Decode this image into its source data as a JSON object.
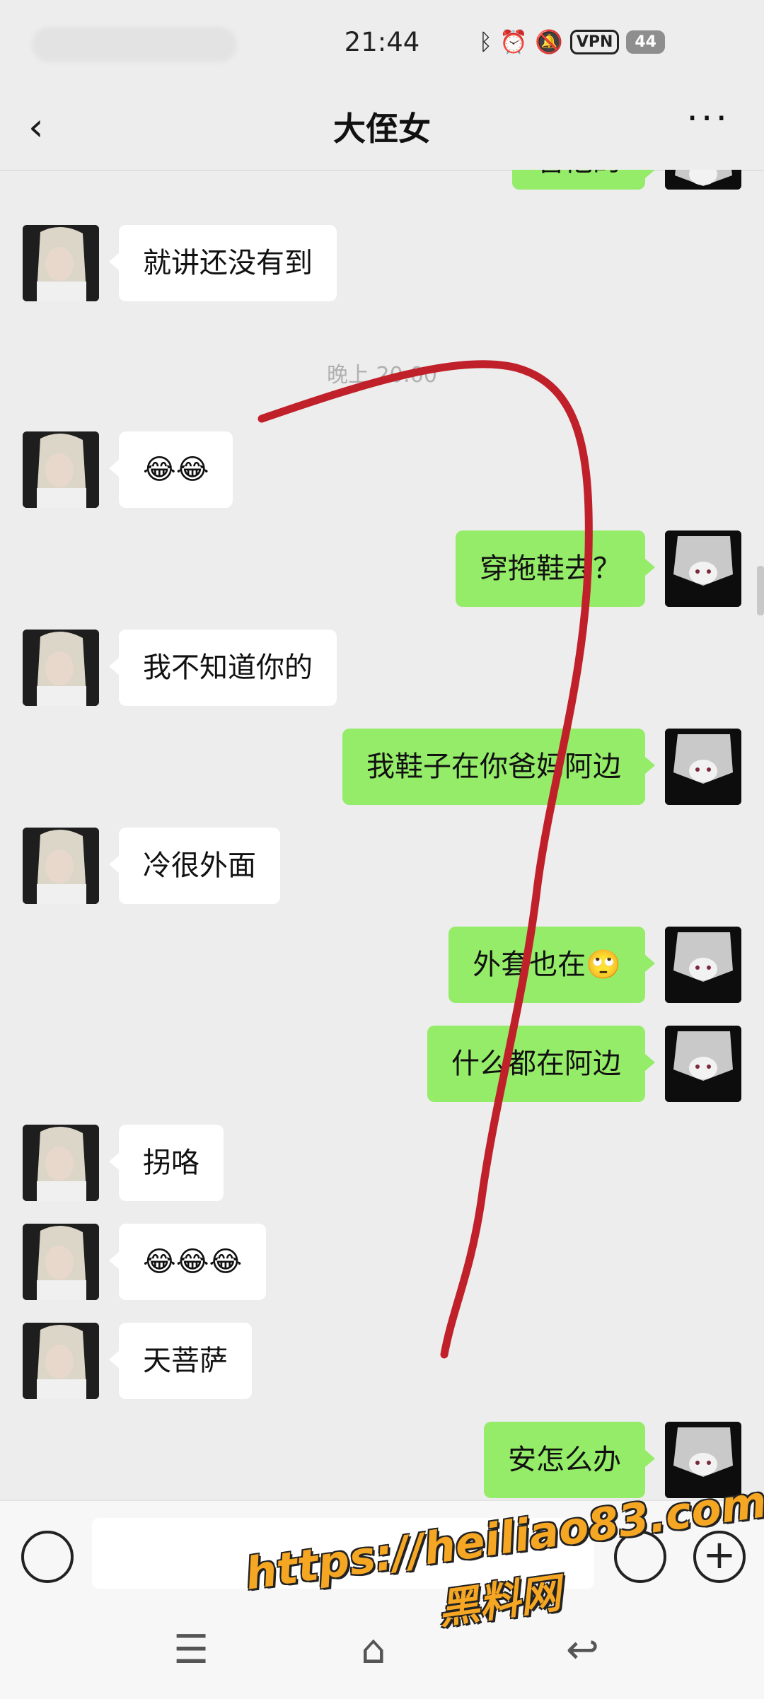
{
  "status_bar": {
    "time": "21:44",
    "icons": [
      "bluetooth-icon",
      "alarm-icon",
      "mute-icon"
    ],
    "vpn_label": "VPN",
    "battery_level": "44"
  },
  "header": {
    "back_symbol": "‹",
    "title": "大侄女",
    "more_symbol": "···"
  },
  "chat": {
    "partial_top_text": "管他的",
    "timestamp": "晚上 20:00",
    "messages": [
      {
        "side": "left",
        "text": "就讲还没有到"
      },
      {
        "side": "left",
        "text": "😂😂"
      },
      {
        "side": "right",
        "text": "穿拖鞋去？"
      },
      {
        "side": "left",
        "text": "我不知道你的"
      },
      {
        "side": "right",
        "text": "我鞋子在你爸妈阿边"
      },
      {
        "side": "left",
        "text": "冷很外面"
      },
      {
        "side": "right",
        "text": "外套也在🙄"
      },
      {
        "side": "right",
        "text": "什么都在阿边"
      },
      {
        "side": "left",
        "text": "拐咯"
      },
      {
        "side": "left",
        "text": "😂😂😂"
      },
      {
        "side": "left",
        "text": "天菩萨"
      },
      {
        "side": "right",
        "text": "安怎么办"
      }
    ]
  },
  "input_bar": {
    "plus_symbol": "+"
  },
  "system_nav": {
    "menu_symbol": "☰",
    "home_symbol": "⌂",
    "back_symbol": "↩"
  },
  "watermark": {
    "url": "https://heiliao83.com",
    "name": "黑料网"
  },
  "colors": {
    "background": "#ededed",
    "bubble_self": "#95ec69",
    "bubble_other": "#ffffff",
    "annotation_stroke": "#c0202a"
  }
}
